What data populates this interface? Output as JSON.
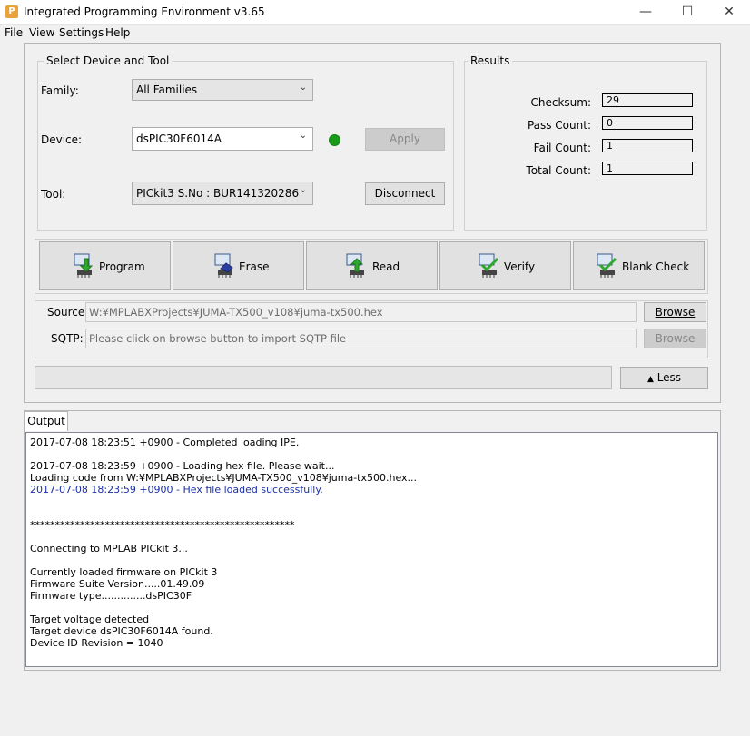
{
  "window": {
    "title": "Integrated Programming Environment v3.65",
    "app_icon": "P",
    "minimize": "—",
    "maximize": "☐",
    "close": "✕"
  },
  "menu": [
    "File",
    "View",
    "Settings",
    "Help"
  ],
  "device_group": {
    "title": "Select Device and Tool",
    "family_label": "Family:",
    "family_value": "All Families",
    "device_label": "Device:",
    "device_value": "dsPIC30F6014A",
    "apply_label": "Apply",
    "tool_label": "Tool:",
    "tool_value": "PICkit3 S.No : BUR141320286",
    "disconnect_label": "Disconnect",
    "status_color": "#1a9a1a"
  },
  "results": {
    "title": "Results",
    "items": [
      {
        "label": "Checksum:",
        "value": "29"
      },
      {
        "label": "Pass Count:",
        "value": "0"
      },
      {
        "label": "Fail Count:",
        "value": "1"
      },
      {
        "label": "Total Count:",
        "value": "1"
      }
    ]
  },
  "actions": [
    {
      "label": "Program",
      "icon": "program-icon"
    },
    {
      "label": "Erase",
      "icon": "erase-icon"
    },
    {
      "label": "Read",
      "icon": "read-icon"
    },
    {
      "label": "Verify",
      "icon": "verify-icon"
    },
    {
      "label": "Blank Check",
      "icon": "blank-check-icon"
    }
  ],
  "source": {
    "label": "Source:",
    "value": "W:¥MPLABXProjects¥JUMA-TX500_v108¥juma-tx500.hex",
    "browse": "Browse"
  },
  "sqtp": {
    "label": "SQTP:",
    "placeholder": "Please click on browse button to import SQTP file",
    "browse": "Browse"
  },
  "less_button": "Less",
  "output": {
    "tab": "Output",
    "lines": [
      {
        "text": "2017-07-08 18:23:51 +0900 - Completed loading IPE.",
        "color": "black"
      },
      {
        "text": "",
        "color": "black"
      },
      {
        "text": "2017-07-08 18:23:59 +0900 - Loading hex file. Please wait...",
        "color": "black"
      },
      {
        "text": "Loading code from W:¥MPLABXProjects¥JUMA-TX500_v108¥juma-tx500.hex...",
        "color": "black"
      },
      {
        "text": "2017-07-08 18:23:59 +0900 - Hex file loaded successfully.",
        "color": "blue"
      },
      {
        "text": "",
        "color": "black"
      },
      {
        "text": "",
        "color": "black"
      },
      {
        "text": "*****************************************************",
        "color": "black"
      },
      {
        "text": "",
        "color": "black"
      },
      {
        "text": "Connecting to MPLAB PICkit 3...",
        "color": "black"
      },
      {
        "text": "",
        "color": "black"
      },
      {
        "text": "Currently loaded firmware on PICkit 3",
        "color": "black"
      },
      {
        "text": "Firmware Suite Version.....01.49.09",
        "color": "black"
      },
      {
        "text": "Firmware type..............dsPIC30F",
        "color": "black"
      },
      {
        "text": "",
        "color": "black"
      },
      {
        "text": "Target voltage detected",
        "color": "black"
      },
      {
        "text": "Target device dsPIC30F6014A found.",
        "color": "black"
      },
      {
        "text": "Device ID Revision = 1040",
        "color": "black"
      }
    ]
  }
}
